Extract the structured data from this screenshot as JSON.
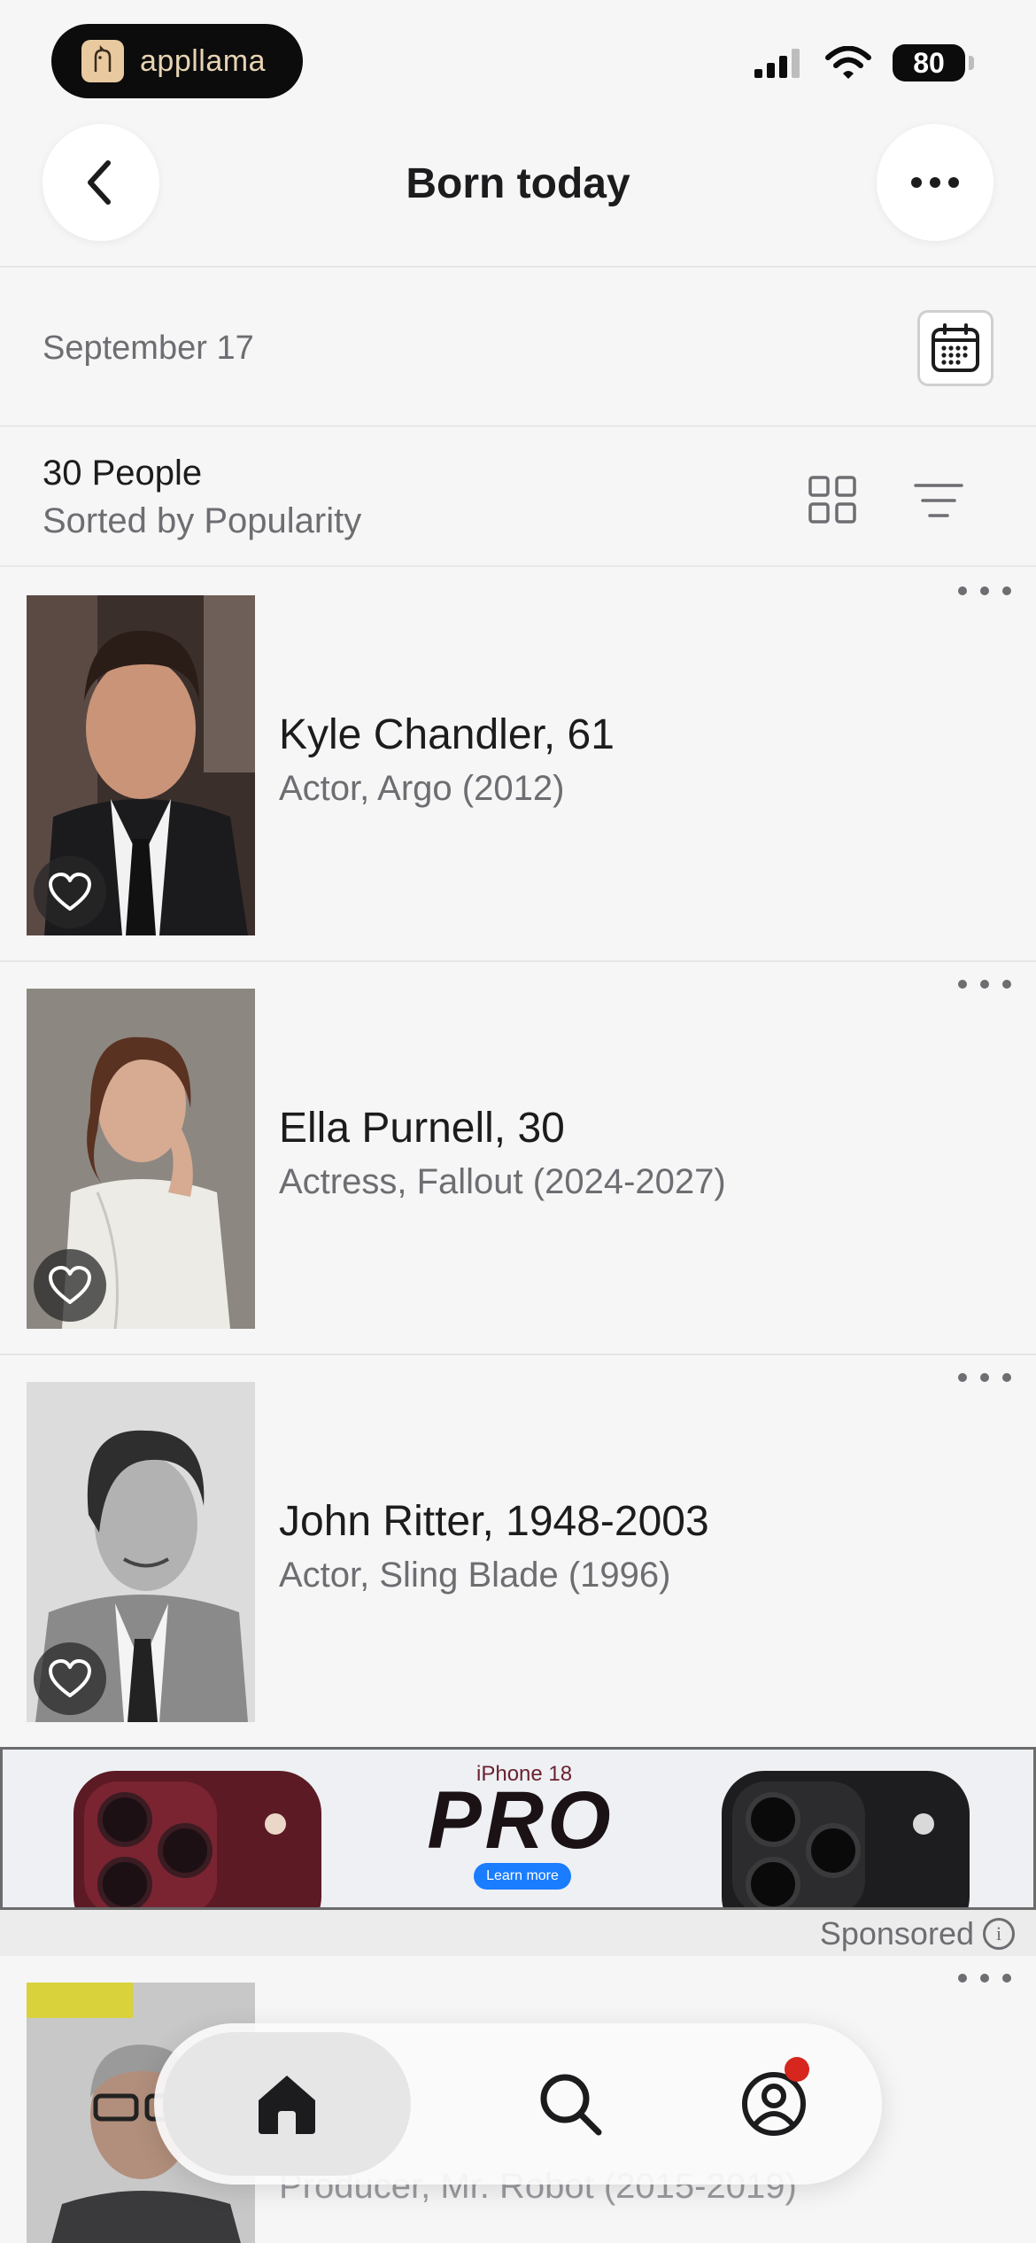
{
  "status_bar": {
    "app_badge": "appllama",
    "battery": "80"
  },
  "header": {
    "title": "Born today"
  },
  "date_row": {
    "date": "September 17"
  },
  "summary": {
    "count": "30 People",
    "sort": "Sorted by Popularity"
  },
  "people": [
    {
      "name": "Kyle Chandler, 61",
      "role": "Actor, Argo (2012)"
    },
    {
      "name": "Ella Purnell, 30",
      "role": "Actress, Fallout (2024-2027)"
    },
    {
      "name": "John Ritter, 1948-2003",
      "role": "Actor, Sling Blade (1996)"
    },
    {
      "name": "",
      "role": "Producer, Mr. Robot (2015-2019)"
    }
  ],
  "ad": {
    "top_text": "iPhone 18",
    "headline": "PRO",
    "cta": "Learn more",
    "sponsored": "Sponsored",
    "info": "i"
  },
  "colors": {
    "notification": "#d7261e",
    "ad_cta": "#1a7cff"
  }
}
